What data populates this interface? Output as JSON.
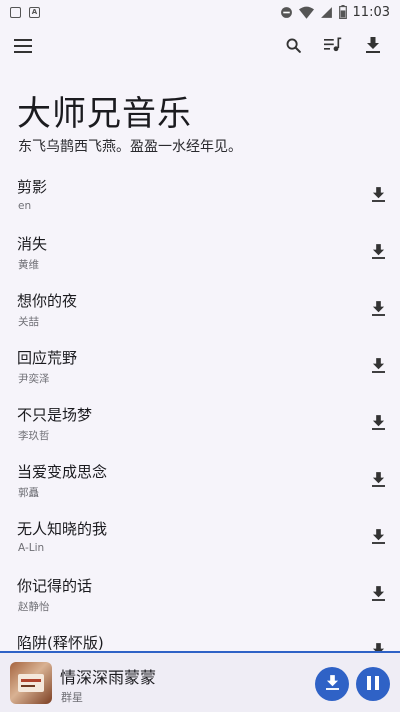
{
  "status_bar": {
    "time": "11:03",
    "left_icons": [
      "notification-box-icon",
      "a-letter-box-icon"
    ],
    "right_icons": [
      "do-not-disturb-icon",
      "wifi-icon",
      "signal-icon",
      "battery-icon"
    ]
  },
  "toolbar": {
    "icons": [
      "menu-icon",
      "search-icon",
      "queue-music-icon",
      "download-icon"
    ]
  },
  "header": {
    "title": "大师兄音乐",
    "subtitle": "东飞乌鹊西飞燕。盈盈一水经年见。"
  },
  "songs": [
    {
      "title": "剪影",
      "artist": "en"
    },
    {
      "title": "消失",
      "artist": "黄维"
    },
    {
      "title": "想你的夜",
      "artist": "关喆"
    },
    {
      "title": "回应荒野",
      "artist": "尹奕泽"
    },
    {
      "title": "不只是场梦",
      "artist": "李玖哲"
    },
    {
      "title": "当爱变成思念",
      "artist": "郭矗"
    },
    {
      "title": "无人知晓的我",
      "artist": "A-Lin"
    },
    {
      "title": "你记得的话",
      "artist": "赵静怡"
    },
    {
      "title": "陷阱(释怀版)",
      "artist": ""
    }
  ],
  "player": {
    "title": "情深深雨蒙蒙",
    "artist": "群星",
    "state": "playing"
  },
  "colors": {
    "accent": "#2f62c6",
    "background": "#f6f4fa",
    "player_background": "#efedf5",
    "secondary_text": "#6f6f75"
  }
}
